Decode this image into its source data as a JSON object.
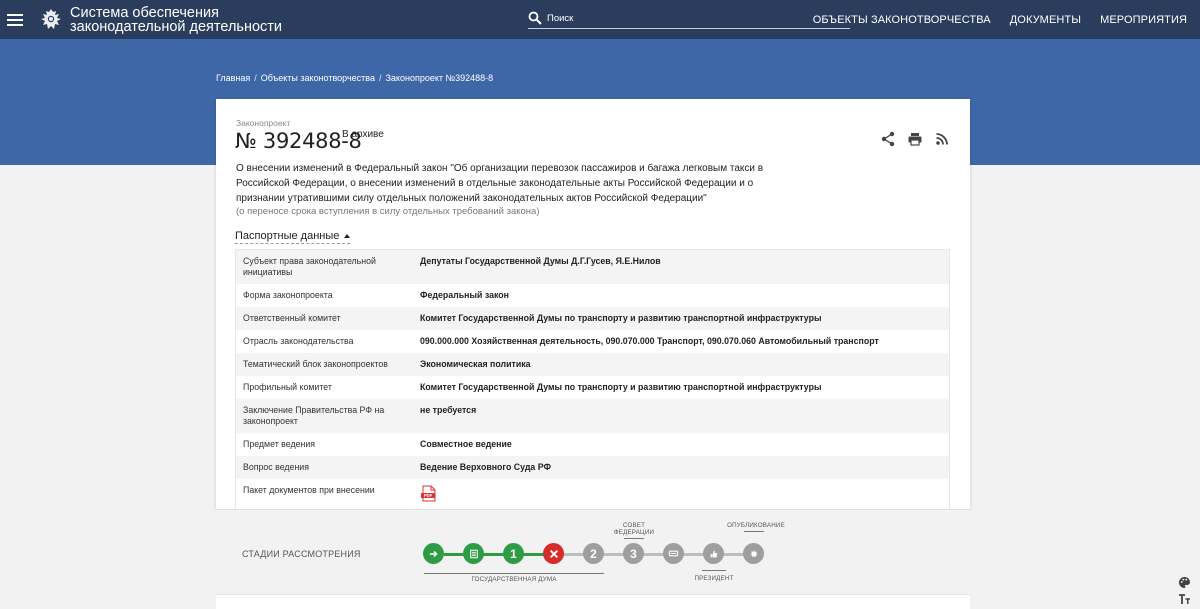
{
  "header": {
    "title_line1": "Система обеспечения",
    "title_line2": "законодательной деятельности",
    "search_placeholder": "Поиск",
    "nav": [
      "ОБЪЕКТЫ ЗАКОНОТВОРЧЕСТВА",
      "ДОКУМЕНТЫ",
      "МЕРОПРИЯТИЯ"
    ]
  },
  "breadcrumb": [
    "Главная",
    "Объекты законотворчества",
    "Законопроект №392488-8"
  ],
  "bill": {
    "kind": "Законопроект",
    "number": "№ 392488-8",
    "status": "В архиве",
    "description": "О внесении изменений в Федеральный закон \"Об организации перевозок пассажиров и багажа легковым такси в Российской Федерации, о внесении изменений в отдельные законодательные акты Российской Федерации и о признании утратившими силу отдельных положений законодательных актов Российской Федерации\"",
    "subdescription": "(о переносе срока вступления в силу отдельных требований закона)",
    "passport_label": "Паспортные данные"
  },
  "passport": [
    {
      "key": "Субъект права законодательной инициативы",
      "value": "Депутаты Государственной Думы Д.Г.Гусев, Я.Е.Нилов"
    },
    {
      "key": "Форма законопроекта",
      "value": "Федеральный закон"
    },
    {
      "key": "Ответственный комитет",
      "value": "Комитет Государственной Думы по транспорту и развитию транспортной инфраструктуры"
    },
    {
      "key": "Отрасль законодательства",
      "value": "090.000.000 Хозяйственная деятельность, 090.070.000 Транспорт, 090.070.060 Автомобильный транспорт"
    },
    {
      "key": "Тематический блок законопроектов",
      "value": "Экономическая политика"
    },
    {
      "key": "Профильный комитет",
      "value": "Комитет Государственной Думы по транспорту и развитию транспортной инфраструктуры"
    },
    {
      "key": "Заключение Правительства РФ на законопроект",
      "value": "не требуется"
    },
    {
      "key": "Предмет ведения",
      "value": "Совместное ведение"
    },
    {
      "key": "Вопрос ведения",
      "value": "Ведение Верховного Суда РФ"
    },
    {
      "key": "Пакет документов при внесении",
      "value": ""
    }
  ],
  "stages": {
    "label": "СТАДИИ РАССМОТРЕНИЯ",
    "steps": [
      "1",
      "2",
      "3"
    ],
    "captions": {
      "duma": "ГОСУДАРСТВЕННАЯ ДУМА",
      "federation_line1": "СОВЕТ",
      "federation_line2": "ФЕДЕРАЦИИ",
      "president": "ПРЕЗИДЕНТ",
      "publication": "ОПУБЛИКОВАНИЕ"
    }
  },
  "colors": {
    "topbar": "#2b3d5c",
    "hero": "#3e67a8",
    "stage_done": "#2e9c45",
    "stage_rejected": "#d62b2b",
    "stage_pending": "#9e9e9e"
  }
}
